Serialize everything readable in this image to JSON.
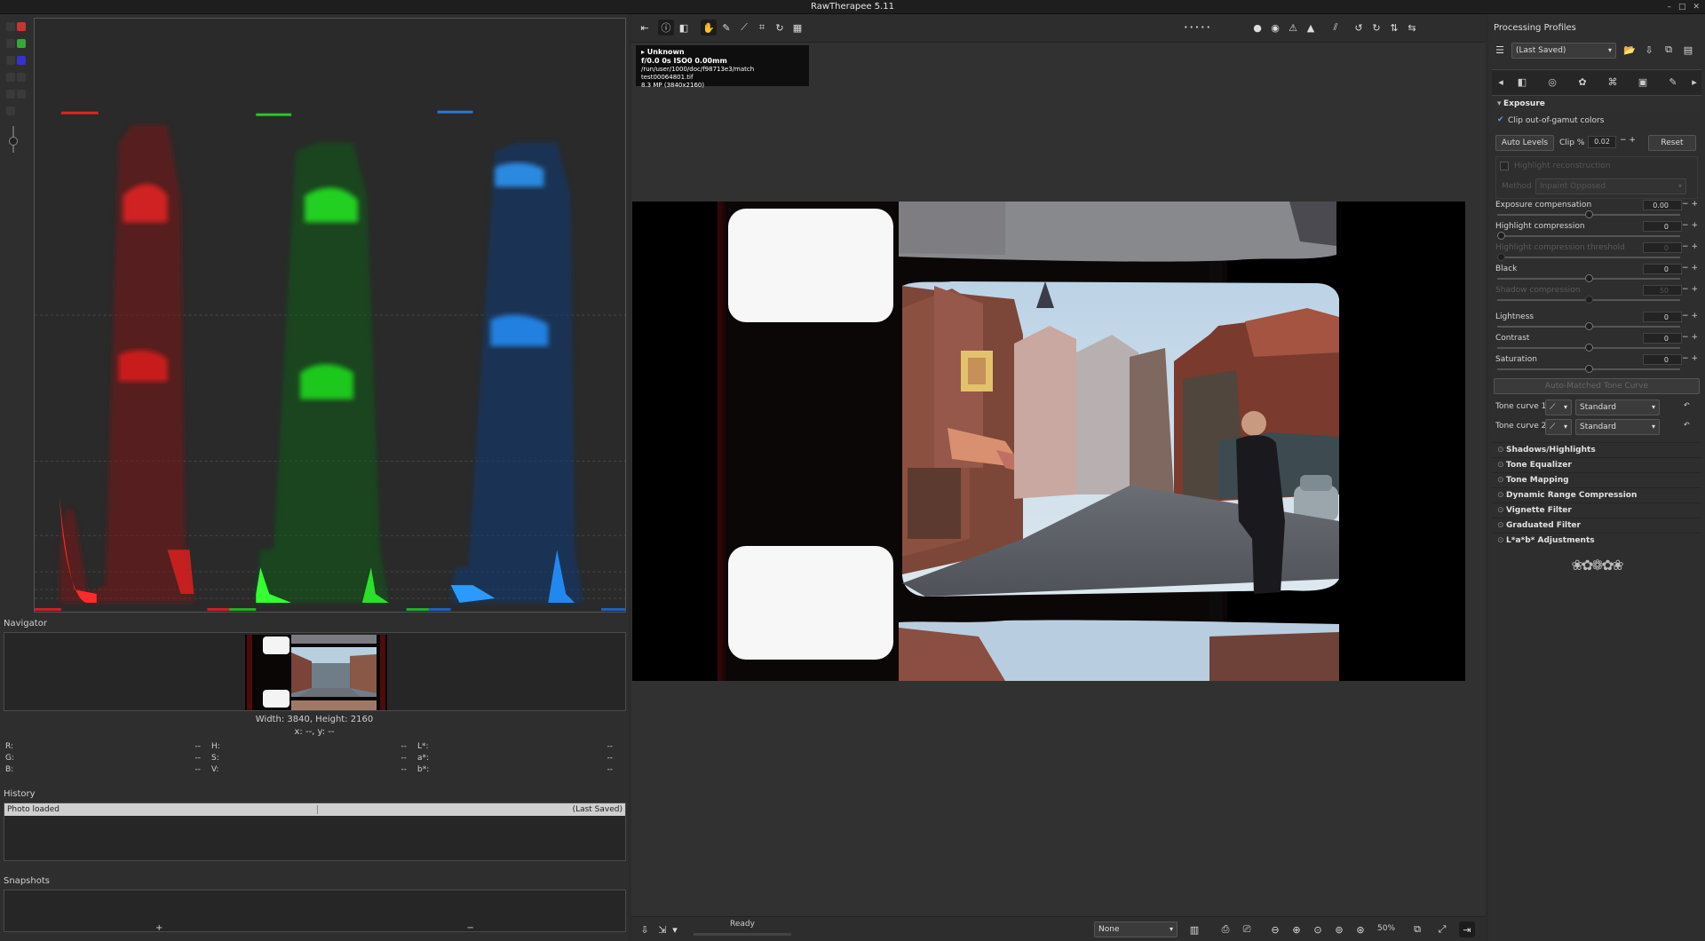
{
  "window": {
    "title": "RawTherapee 5.11",
    "controls": [
      "–",
      "□",
      "✕"
    ]
  },
  "left": {
    "navigator_label": "Navigator",
    "dimensions": "Width: 3840, Height: 2160",
    "coords": "x: --, y: --",
    "readout": [
      [
        {
          "k": "R:",
          "v": "--"
        },
        {
          "k": "H:",
          "v": "--"
        },
        {
          "k": "L*:",
          "v": "--"
        }
      ],
      [
        {
          "k": "G:",
          "v": "--"
        },
        {
          "k": "S:",
          "v": "--"
        },
        {
          "k": "a*:",
          "v": "--"
        }
      ],
      [
        {
          "k": "B:",
          "v": "--"
        },
        {
          "k": "V:",
          "v": "--"
        },
        {
          "k": "b*:",
          "v": "--"
        }
      ]
    ],
    "history_label": "History",
    "history_items": [
      {
        "action": "Photo loaded",
        "value": "(Last Saved)"
      }
    ],
    "snapshots_label": "Snapshots",
    "snap_add": "+",
    "snap_remove": "−"
  },
  "center": {
    "info": {
      "camera": "▸ Unknown",
      "exposure": "f/0.0  0s  ISO0  0.00mm",
      "path": "/run/user/1000/doc/f98713e3/match test00064801.tif",
      "size": "8.3 MP (3840x2160)"
    },
    "status": "Ready",
    "zoom": "50%",
    "output_profile": "None"
  },
  "right": {
    "profiles_title": "Processing Profiles",
    "profile_value": "(Last Saved)",
    "exposure_title": "Exposure",
    "clip_gamut": "Clip out-of-gamut colors",
    "auto_levels": "Auto Levels",
    "clip_label": "Clip %",
    "clip_value": "0.02",
    "reset": "Reset",
    "highlight_recon": "Highlight reconstruction",
    "method_label": "Method",
    "method_value": "Inpaint Opposed",
    "sliders": [
      {
        "label": "Exposure compensation",
        "value": "0.00",
        "pos": 0.5,
        "dim": false
      },
      {
        "label": "Highlight compression",
        "value": "0",
        "pos": 0.0,
        "dim": false
      },
      {
        "label": "Highlight compression threshold",
        "value": "0",
        "pos": 0.0,
        "dim": true
      },
      {
        "label": "Black",
        "value": "0",
        "pos": 0.5,
        "dim": false
      },
      {
        "label": "Shadow compression",
        "value": "50",
        "pos": 0.5,
        "dim": true
      },
      {
        "label": "Lightness",
        "value": "0",
        "pos": 0.5,
        "dim": false
      },
      {
        "label": "Contrast",
        "value": "0",
        "pos": 0.5,
        "dim": false
      },
      {
        "label": "Saturation",
        "value": "0",
        "pos": 0.5,
        "dim": false
      }
    ],
    "auto_matched": "Auto-Matched Tone Curve",
    "tone_curve_1": "Tone curve 1:",
    "tone_curve_2": "Tone curve 2:",
    "curve_mode": "Standard",
    "folds": [
      "Shadows/Highlights",
      "Tone Equalizer",
      "Tone Mapping",
      "Dynamic Range Compression",
      "Vignette Filter",
      "Graduated Filter",
      "L*a*b* Adjustments"
    ]
  }
}
